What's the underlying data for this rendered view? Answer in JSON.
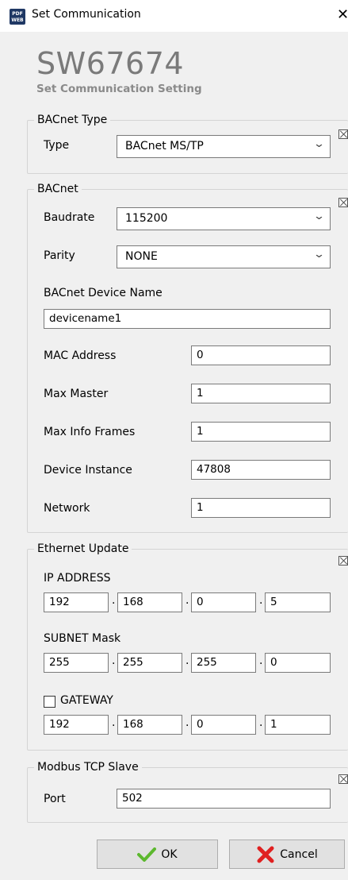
{
  "window": {
    "title": "Set Communication",
    "icon_text": [
      "PDF",
      "WEB"
    ]
  },
  "header": {
    "code": "SW67674",
    "subtitle": "Set Communication Setting"
  },
  "bacnet_type": {
    "legend": "BACnet Type",
    "type_label": "Type",
    "type_value": "BACnet MS/TP"
  },
  "bacnet": {
    "legend": "BACnet",
    "baudrate_label": "Baudrate",
    "baudrate_value": "115200",
    "parity_label": "Parity",
    "parity_value": "NONE",
    "device_name_label": "BACnet Device Name",
    "device_name_value": "devicename1",
    "mac_label": "MAC Address",
    "mac_value": "0",
    "max_master_label": "Max Master",
    "max_master_value": "1",
    "max_info_label": "Max Info Frames",
    "max_info_value": "1",
    "device_instance_label": "Device Instance",
    "device_instance_value": "47808",
    "network_label": "Network",
    "network_value": "1"
  },
  "ethernet": {
    "legend": "Ethernet Update",
    "ip_label": "IP ADDRESS",
    "ip": [
      "192",
      "168",
      "0",
      "5"
    ],
    "subnet_label": "SUBNET Mask",
    "subnet": [
      "255",
      "255",
      "255",
      "0"
    ],
    "gateway_label": "GATEWAY",
    "gateway_checked": false,
    "gateway": [
      "192",
      "168",
      "0",
      "1"
    ],
    "separator": "."
  },
  "modbus": {
    "legend": "Modbus TCP Slave",
    "port_label": "Port",
    "port_value": "502"
  },
  "buttons": {
    "ok": "OK",
    "cancel": "Cancel"
  },
  "colors": {
    "panel": "#f0f0f0",
    "ok_check": "#5cb82e",
    "cancel_x": "#e02020"
  }
}
